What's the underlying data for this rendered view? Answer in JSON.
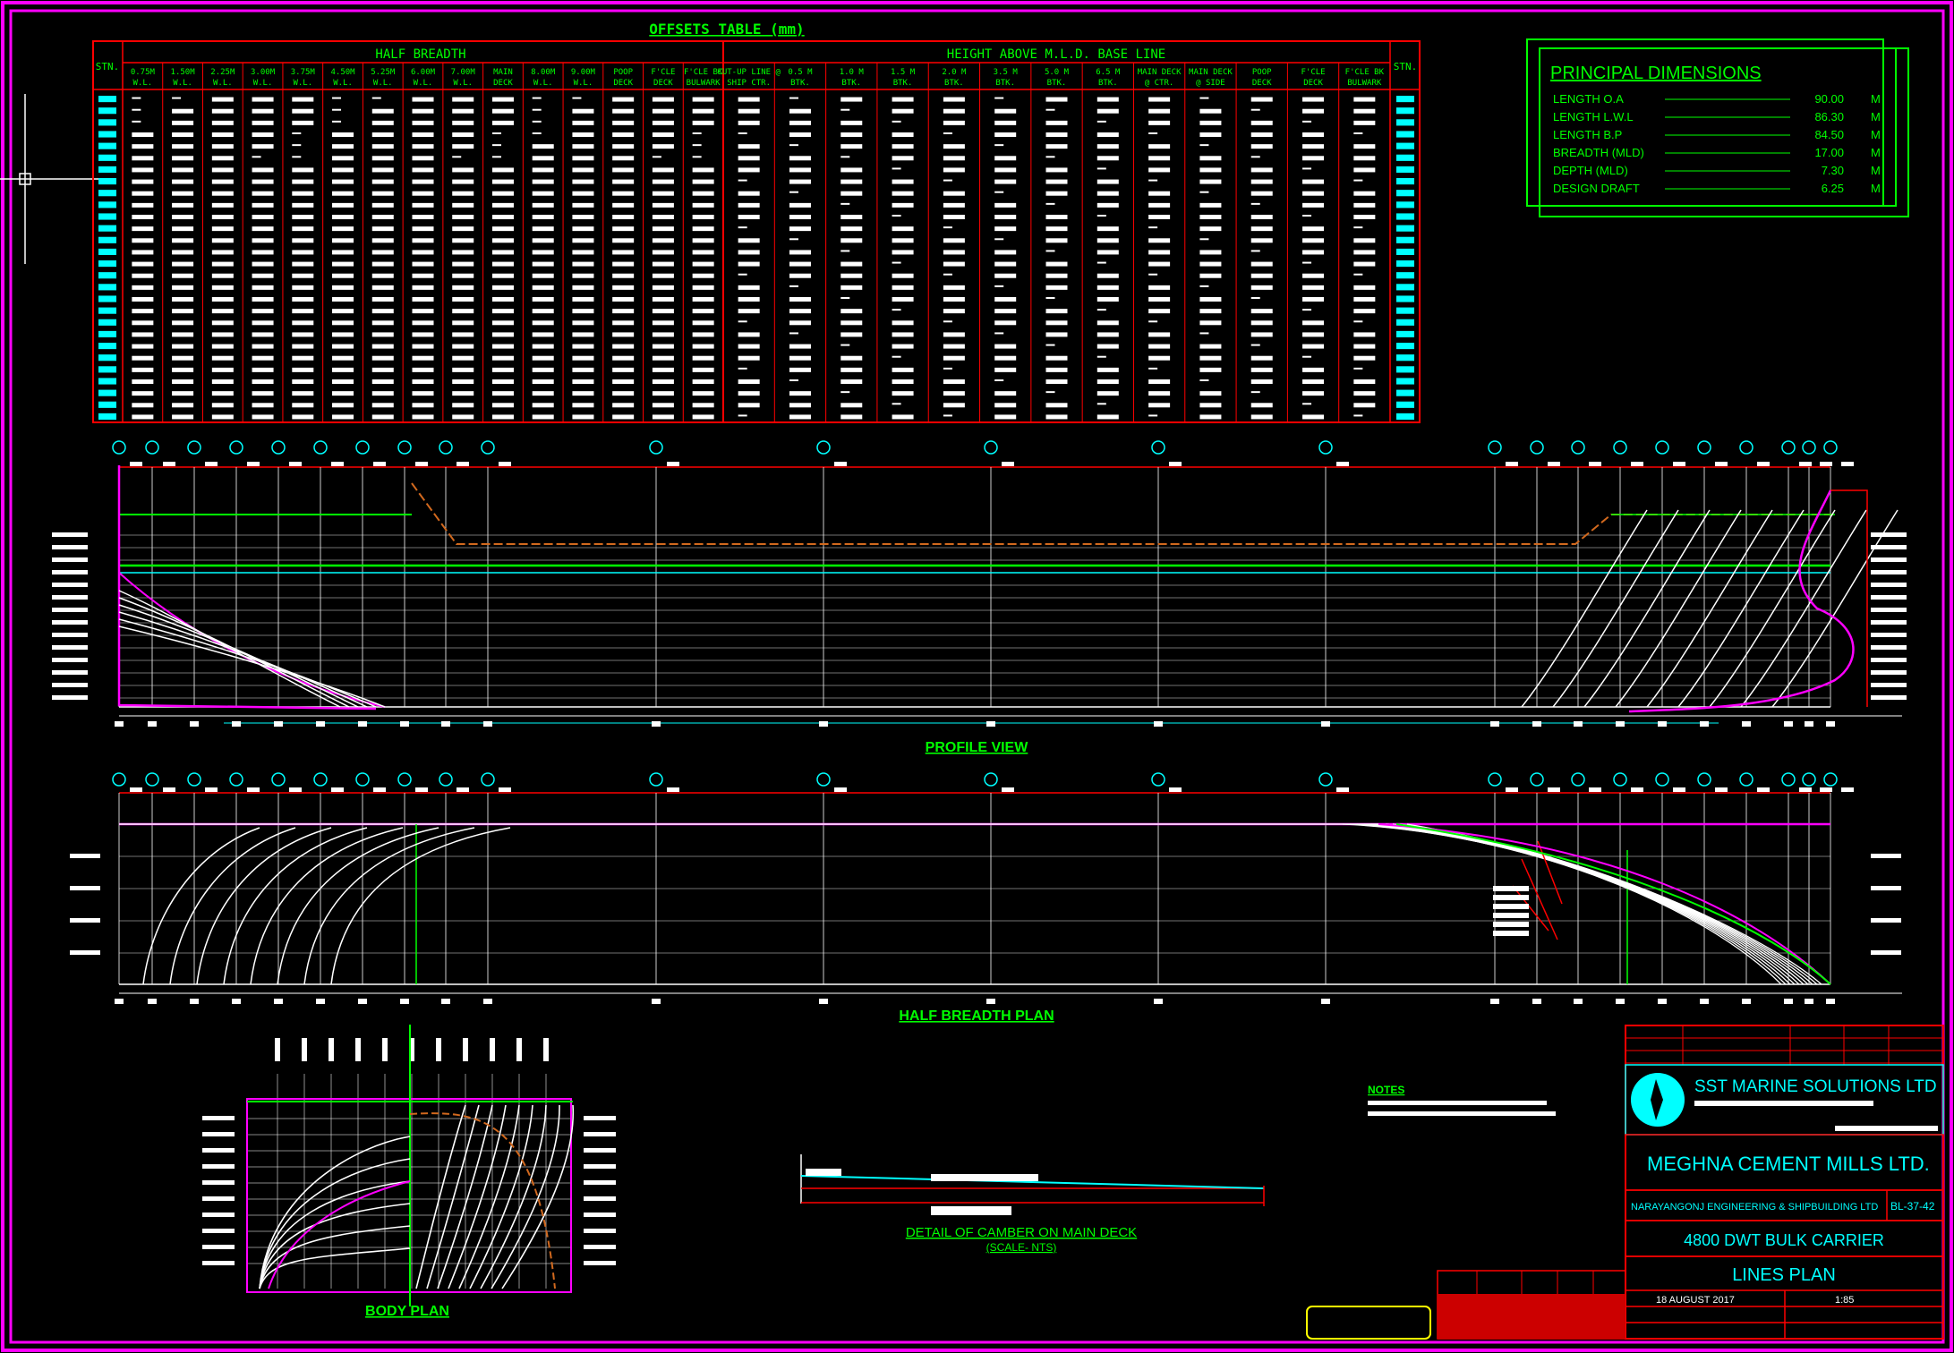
{
  "offsets_table": {
    "title": "OFFSETS TABLE (mm)",
    "stn_label": "STN.",
    "half_breadth_header": "HALF BREADTH",
    "height_header": "HEIGHT ABOVE M.L.D. BASE LINE",
    "half_breadth_columns": [
      "0.75M W.L.",
      "1.50M W.L.",
      "2.25M W.L.",
      "3.00M W.L.",
      "3.75M W.L.",
      "4.50M W.L.",
      "5.25M W.L.",
      "6.00M W.L.",
      "7.00M W.L.",
      "MAIN DECK",
      "8.00M W.L.",
      "9.00M W.L.",
      "POOP DECK",
      "F'CLE DECK",
      "F'CLE BK BULWARK"
    ],
    "height_columns": [
      "CUT-UP LINE @ SHIP CTR.",
      "0.5 M BTK.",
      "1.0 M BTK.",
      "1.5 M BTK.",
      "2.0 M BTK.",
      "3.5 M BTK.",
      "5.0 M BTK.",
      "6.5 M BTK.",
      "MAIN DECK @ CTR.",
      "MAIN DECK @ SIDE",
      "POOP DECK",
      "F'CLE DECK",
      "F'CLE BK BULWARK"
    ]
  },
  "principal_dimensions": {
    "title": "PRINCIPAL DIMENSIONS",
    "rows": [
      {
        "label": "LENGTH O.A",
        "value": "90.00",
        "unit": "M"
      },
      {
        "label": "LENGTH L.W.L",
        "value": "86.30",
        "unit": "M"
      },
      {
        "label": "LENGTH B.P",
        "value": "84.50",
        "unit": "M"
      },
      {
        "label": "BREADTH (MLD)",
        "value": "17.00",
        "unit": "M"
      },
      {
        "label": "DEPTH (MLD)",
        "value": "7.30",
        "unit": "M"
      },
      {
        "label": "DESIGN DRAFT",
        "value": "6.25",
        "unit": "M"
      }
    ]
  },
  "views": {
    "profile": "PROFILE VIEW",
    "half_breadth": "HALF BREADTH PLAN",
    "body": "BODY PLAN",
    "camber": "DETAIL OF CAMBER ON MAIN DECK",
    "camber_scale": "(SCALE- NTS)",
    "notes": "NOTES"
  },
  "title_block": {
    "company": "SST MARINE SOLUTIONS LTD",
    "client": "MEGHNA CEMENT MILLS LTD.",
    "builder": "NARAYANGONJ ENGINEERING & SHIPBUILDING LTD",
    "drawing_no": "BL-37-42",
    "project": "4800 DWT BULK CARRIER",
    "title": "LINES PLAN",
    "date": "18 AUGUST 2017",
    "scale": "1:85"
  }
}
